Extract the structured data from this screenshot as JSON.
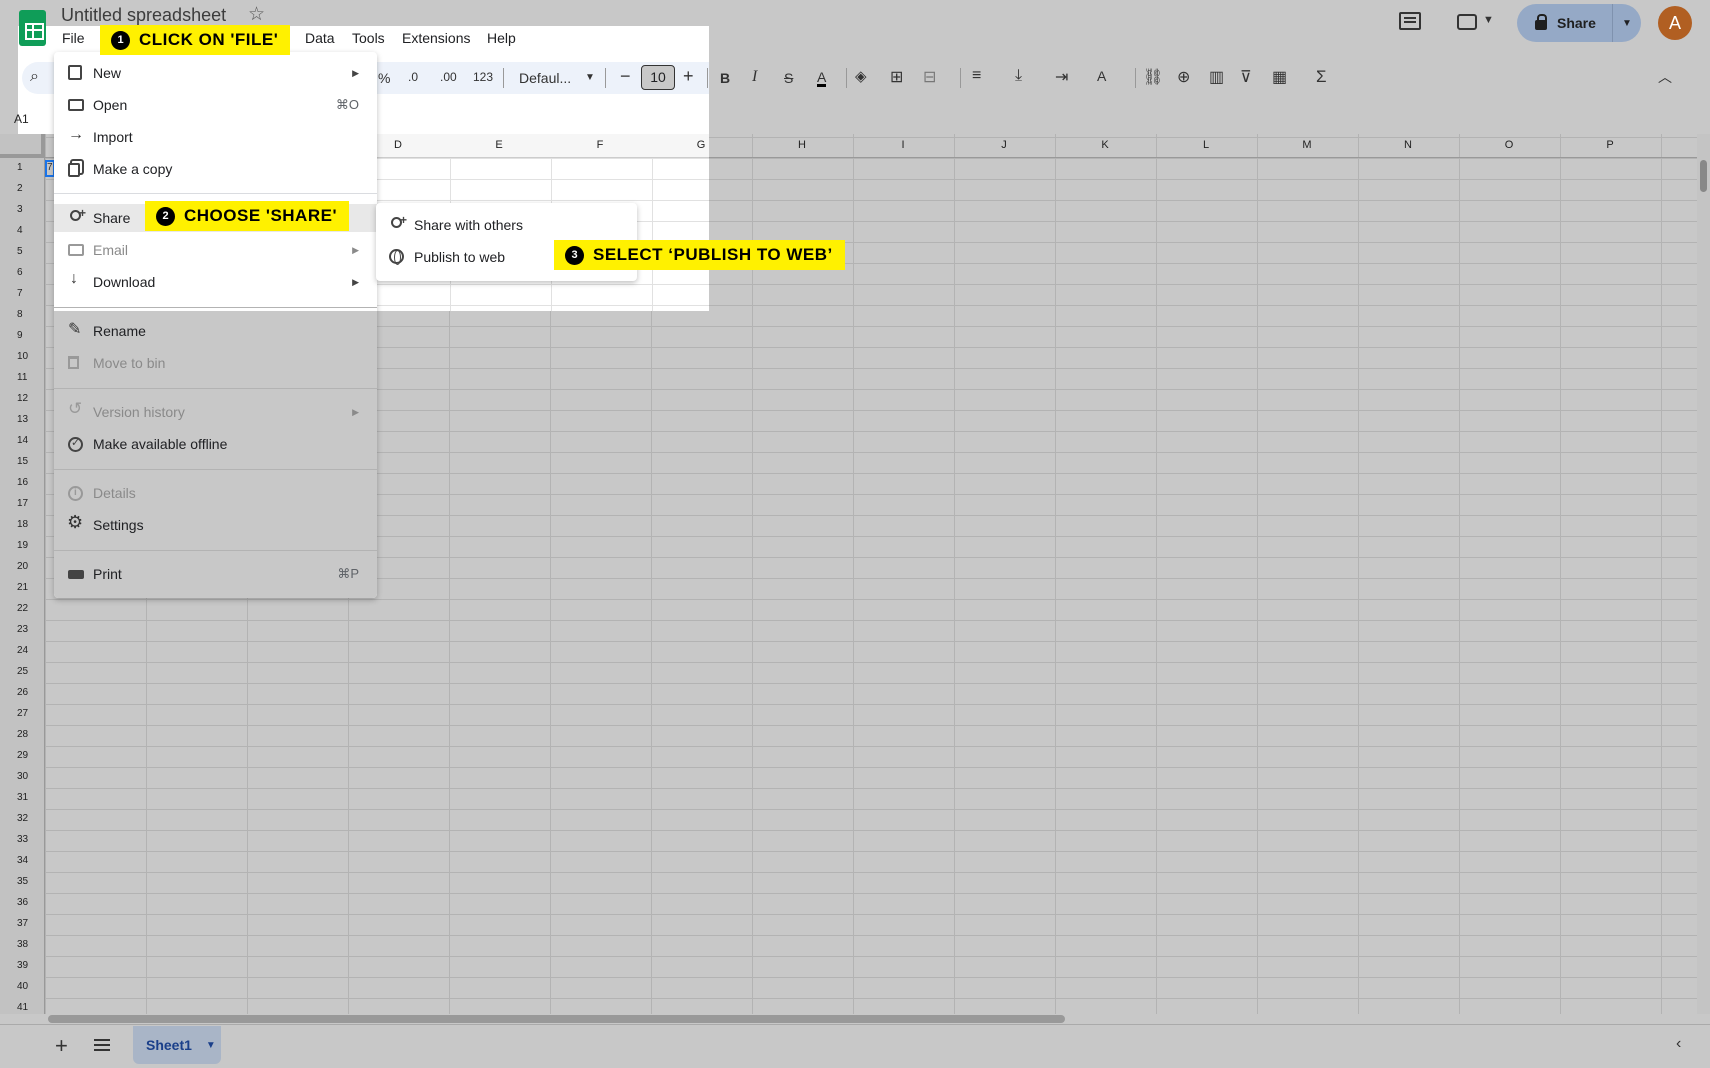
{
  "app": {
    "title": "Untitled spreadsheet",
    "menus": [
      "File",
      "Data",
      "Tools",
      "Extensions",
      "Help"
    ]
  },
  "toolbar": {
    "percent": "%",
    "dec_decrease": ".0",
    "dec_increase": ".00",
    "number_format": "123",
    "font": "Defaul...",
    "font_size": "10",
    "minus": "−",
    "plus": "+",
    "bold": "B",
    "italic": "I",
    "strike": "S",
    "text_color": "A",
    "sum": "Σ"
  },
  "name_box": "A1",
  "cell_a1_partial": "7",
  "header": {
    "share_label": "Share",
    "avatar_initial": "A"
  },
  "columns": [
    "D",
    "E",
    "F",
    "G",
    "H",
    "I",
    "J",
    "K",
    "L",
    "M",
    "N",
    "O",
    "P"
  ],
  "rows": [
    "1",
    "2",
    "3",
    "4",
    "5",
    "6",
    "7",
    "8",
    "9",
    "10",
    "11",
    "12",
    "13",
    "14",
    "15",
    "16",
    "17",
    "18",
    "19",
    "20",
    "21",
    "22",
    "23",
    "24",
    "25",
    "26",
    "27",
    "28",
    "29",
    "30",
    "31",
    "32",
    "33",
    "34",
    "35",
    "36",
    "37",
    "38",
    "39",
    "40",
    "41"
  ],
  "file_menu": {
    "items": [
      {
        "label": "New",
        "icon": "new-doc-icon",
        "submenu": true
      },
      {
        "label": "Open",
        "icon": "folder-icon",
        "shortcut": "⌘O"
      },
      {
        "label": "Import",
        "icon": "import-icon"
      },
      {
        "label": "Make a copy",
        "icon": "copy-icon"
      },
      {
        "label": "Share",
        "icon": "share-person-icon",
        "submenu": true
      },
      {
        "label": "Email",
        "icon": "email-icon",
        "submenu": true,
        "disabled": true
      },
      {
        "label": "Download",
        "icon": "download-icon",
        "submenu": true
      },
      {
        "label": "Rename",
        "icon": "rename-icon"
      },
      {
        "label": "Move to bin",
        "icon": "bin-icon",
        "disabled": true
      },
      {
        "label": "Version history",
        "icon": "history-icon",
        "submenu": true,
        "disabled": true
      },
      {
        "label": "Make available offline",
        "icon": "offline-icon"
      },
      {
        "label": "Details",
        "icon": "info-icon",
        "disabled": true
      },
      {
        "label": "Settings",
        "icon": "gear-icon"
      },
      {
        "label": "Print",
        "icon": "print-icon",
        "shortcut": "⌘P"
      }
    ]
  },
  "share_submenu": {
    "items": [
      {
        "label": "Share with others",
        "icon": "share-person-icon"
      },
      {
        "label": "Publish to web",
        "icon": "globe-icon"
      }
    ]
  },
  "callouts": [
    {
      "num": "1",
      "text": "CLICK ON 'FILE'"
    },
    {
      "num": "2",
      "text": "CHOOSE 'SHARE'"
    },
    {
      "num": "3",
      "text": "SELECT ‘PUBLISH TO WEB’"
    }
  ],
  "sheet_tab": "Sheet1",
  "colors": {
    "callout": "#fff100",
    "sheets_green": "#0f9d58",
    "share_button": "#95a9c6",
    "avatar": "#b15f22",
    "tab_text": "#1a3f8a"
  }
}
